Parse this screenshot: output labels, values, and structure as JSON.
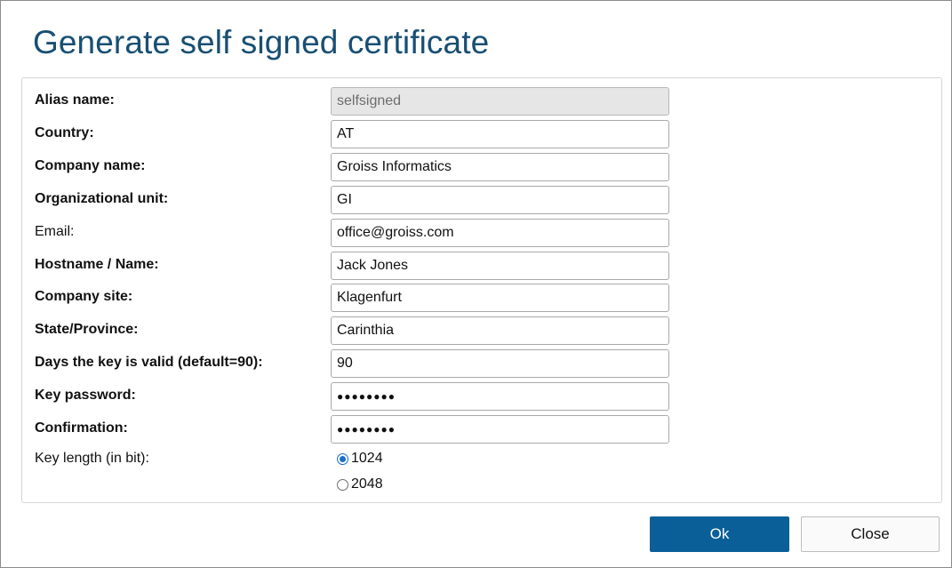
{
  "dialog": {
    "title": "Generate self signed certificate"
  },
  "form": {
    "fields": [
      {
        "label": "Alias name:",
        "value": "selfsigned",
        "bold": true,
        "disabled": true
      },
      {
        "label": "Country:",
        "value": "AT",
        "bold": true
      },
      {
        "label": "Company name:",
        "value": "Groiss Informatics",
        "bold": true
      },
      {
        "label": "Organizational unit:",
        "value": "GI",
        "bold": true
      },
      {
        "label": "Email:",
        "value": "office@groiss.com",
        "bold": false
      },
      {
        "label": "Hostname / Name:",
        "value": "Jack Jones",
        "bold": true
      },
      {
        "label": "Company site:",
        "value": "Klagenfurt",
        "bold": true
      },
      {
        "label": "State/Province:",
        "value": "Carinthia",
        "bold": true
      },
      {
        "label": "Days the key is valid (default=90):",
        "value": "90",
        "bold": true
      },
      {
        "label": "Key password:",
        "value": "●●●●●●●●",
        "bold": true,
        "password": true
      },
      {
        "label": "Confirmation:",
        "value": "●●●●●●●●",
        "bold": true,
        "password": true
      }
    ],
    "key_length": {
      "label": "Key length (in bit):",
      "options": [
        {
          "label": "1024",
          "checked": true
        },
        {
          "label": "2048",
          "checked": false
        }
      ]
    }
  },
  "buttons": {
    "ok_label": "Ok",
    "close_label": "Close"
  },
  "colors": {
    "title": "#184f73",
    "primary_button": "#0a5f99",
    "radio_selected": "#1a6fc9"
  }
}
